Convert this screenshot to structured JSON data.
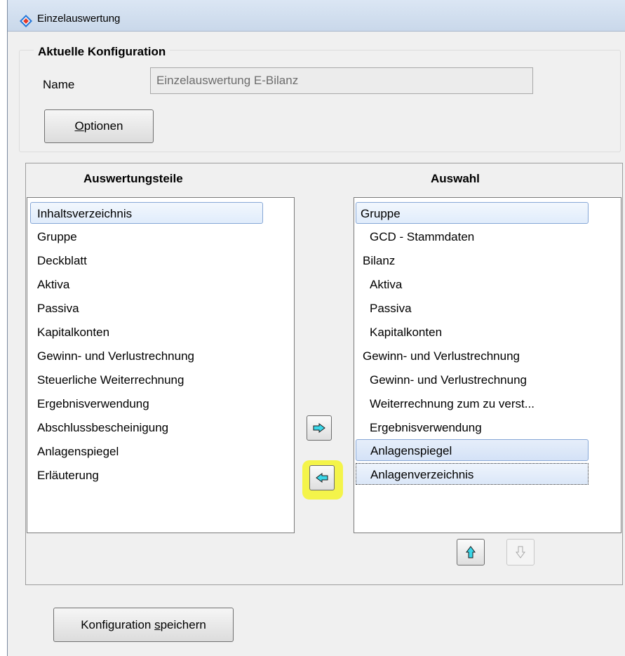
{
  "window": {
    "title": "Einzelauswertung"
  },
  "config": {
    "legend": "Aktuelle Konfiguration",
    "name_label": "Name",
    "name_value": "Einzelauswertung  E-Bilanz",
    "options_prefix": "",
    "options_underline": "O",
    "options_rest": "ptionen"
  },
  "left_list": {
    "header": "Auswertungsteile",
    "items": [
      "Inhaltsverzeichnis",
      "Gruppe",
      "Deckblatt",
      "Aktiva",
      "Passiva",
      "Kapitalkonten",
      "Gewinn- und Verlustrechnung",
      "Steuerliche Weiterrechnung",
      "Ergebnisverwendung",
      "Abschlussbescheinigung",
      "Anlagenspiegel",
      "Erläuterung"
    ]
  },
  "right_list": {
    "header": "Auswahl",
    "items": [
      "Gruppe",
      "GCD - Stammdaten",
      "Bilanz",
      "Aktiva",
      "Passiva",
      "Kapitalkonten",
      "Gewinn- und Verlustrechnung",
      "Gewinn- und Verlustrechnung",
      "Weiterrechnung zum zu verst...",
      "Ergebnisverwendung",
      "Anlagenspiegel",
      "Anlagenverzeichnis"
    ]
  },
  "save_button": {
    "prefix": "Konfiguration ",
    "underline": "s",
    "rest": "peichern"
  },
  "icons": {
    "add": "arrow-right-icon",
    "remove": "arrow-left-icon",
    "up": "arrow-up-icon",
    "down": "arrow-down-icon"
  },
  "colors": {
    "arrow_fill": "#3ad6e8",
    "highlight": "#f4f44a"
  }
}
